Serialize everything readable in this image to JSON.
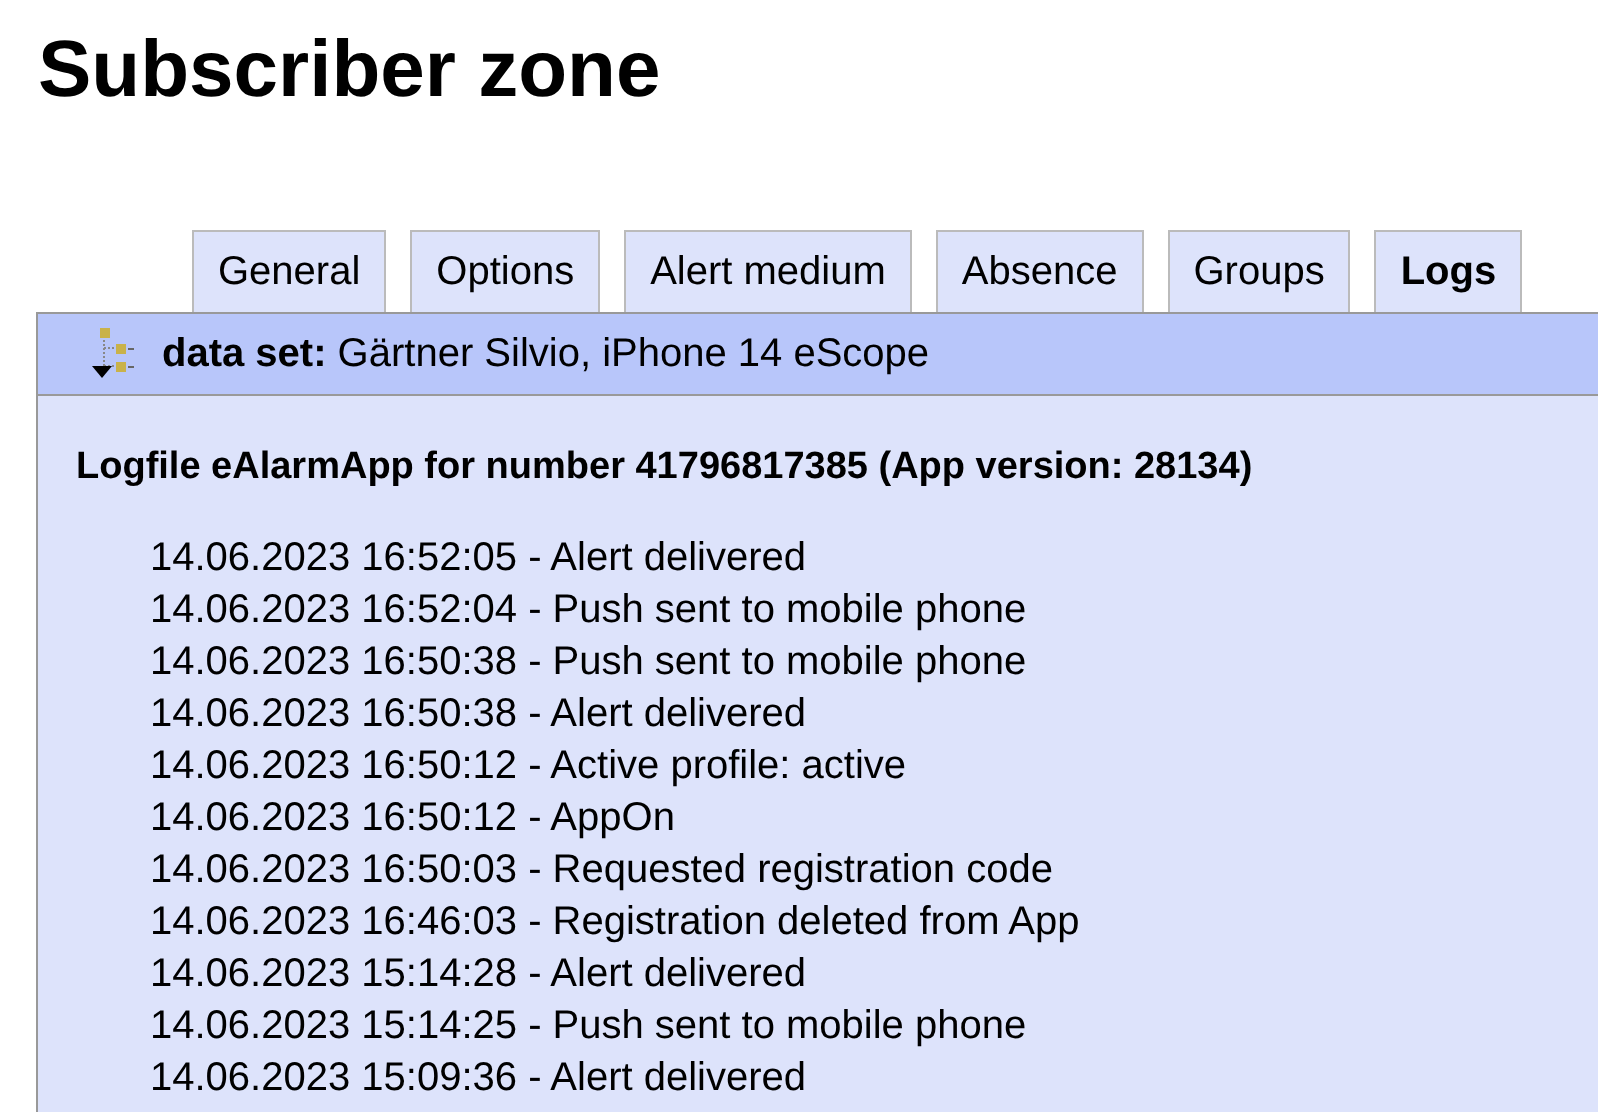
{
  "page": {
    "title": "Subscriber zone"
  },
  "tabs": [
    {
      "label": "General",
      "selected": false
    },
    {
      "label": "Options",
      "selected": false
    },
    {
      "label": "Alert medium",
      "selected": false
    },
    {
      "label": "Absence",
      "selected": false
    },
    {
      "label": "Groups",
      "selected": false
    },
    {
      "label": "Logs",
      "selected": true
    }
  ],
  "data_set": "**data set:** Gärtner Silvio, iPhone 14 eScope",
  "log": {
    "heading": "Logfile eAlarmApp for number 41796817385 (App version: 28134)",
    "entries": [
      "14.06.2023 16:52:05 - Alert delivered",
      "14.06.2023 16:52:04 - Push sent to mobile phone",
      "14.06.2023 16:50:38 - Push sent to mobile phone",
      "14.06.2023 16:50:38 - Alert delivered",
      "14.06.2023 16:50:12 - Active profile: active",
      "14.06.2023 16:50:12 - AppOn",
      "14.06.2023 16:50:03 - Requested registration code",
      "14.06.2023 16:46:03 - Registration deleted from App",
      "14.06.2023 15:14:28 - Alert delivered",
      "14.06.2023 15:14:25 - Push sent to mobile phone",
      "14.06.2023 15:09:36 - Alert delivered"
    ]
  }
}
